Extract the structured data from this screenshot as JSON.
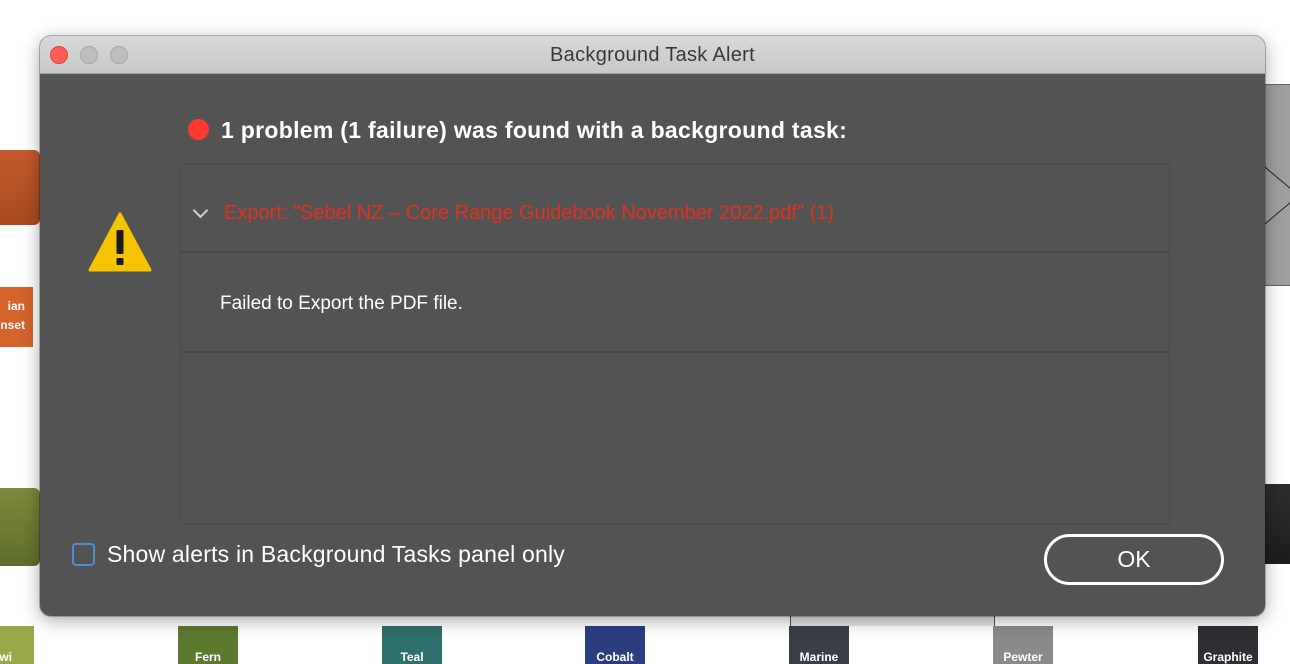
{
  "window": {
    "title": "Background Task Alert",
    "controls": [
      "close",
      "minimize",
      "maximize"
    ]
  },
  "alert": {
    "headline": "1 problem (1 failure) was found with a background task:",
    "status_color": "#ff3b30",
    "icon": "warning-triangle-icon",
    "problems": [
      {
        "title": "Export: \"Sebel NZ – Core Range Guidebook November 2022.pdf\" (1)",
        "expanded": true,
        "detail": "Failed to Export the PDF file."
      }
    ]
  },
  "footer": {
    "checkbox_label": "Show alerts in Background Tasks panel only",
    "checkbox_checked": false,
    "ok_label": "OK"
  },
  "background": {
    "tag_lines": [
      "ian",
      "nset"
    ],
    "swatches": [
      {
        "label": "iwi",
        "color": "#9aa64a"
      },
      {
        "label": "Fern",
        "color": "#5c7a2f"
      },
      {
        "label": "Teal",
        "color": "#2f6f6c"
      },
      {
        "label": "Cobalt",
        "color": "#2b3f80"
      },
      {
        "label": "Marine",
        "color": "#3a3f47"
      },
      {
        "label": "Pewter",
        "color": "#8a8a8a"
      },
      {
        "label": "Graphite",
        "color": "#2e2e33"
      }
    ]
  },
  "colors": {
    "dialog_bg": "#535353",
    "error_text": "#e0301e",
    "checkbox_border": "#4c8fd8"
  }
}
